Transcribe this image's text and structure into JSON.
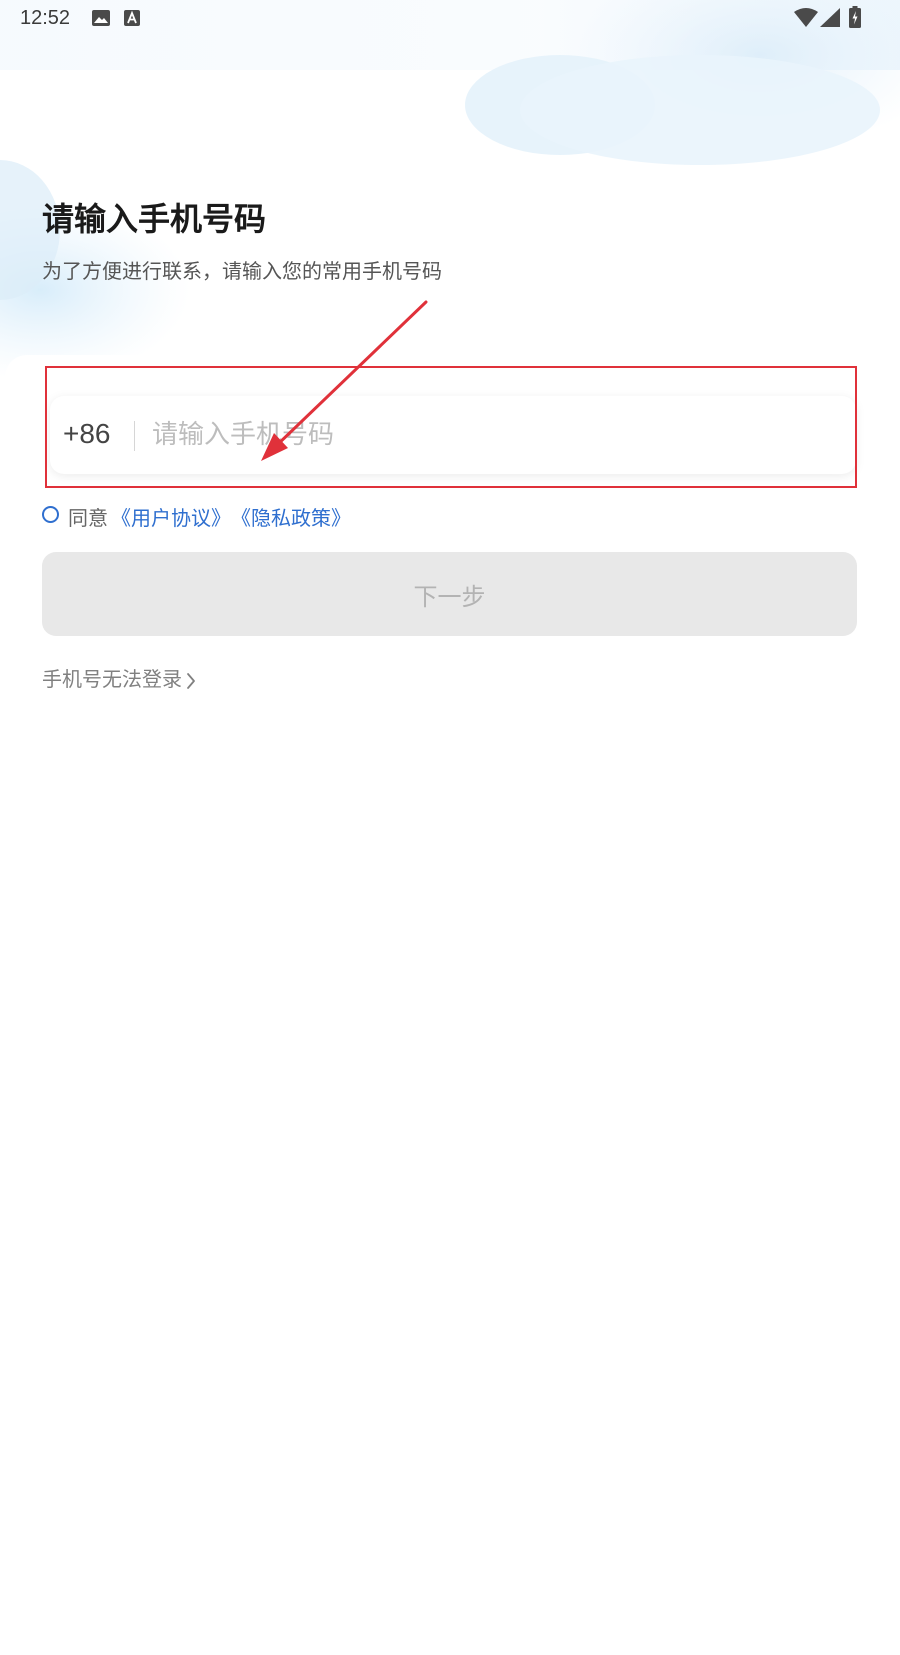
{
  "status_bar": {
    "time": "12:52",
    "left_icons": [
      "image-icon",
      "a-icon"
    ],
    "right_icons": [
      "wifi-icon",
      "cellular-signal-icon",
      "battery-charging-icon"
    ]
  },
  "header": {
    "title": "请输入手机号码",
    "subtitle": "为了方便进行联系，请输入您的常用手机号码"
  },
  "phone_input": {
    "country_code": "+86",
    "placeholder": "请输入手机号码",
    "value": ""
  },
  "agreement": {
    "checked": false,
    "prefix": "同意",
    "user_agreement": "《用户协议》",
    "privacy_policy": "《隐私政策》"
  },
  "next_button": {
    "label": "下一步",
    "enabled": false
  },
  "help_link": {
    "label": "手机号无法登录"
  },
  "colors": {
    "link": "#2f6fcf",
    "annotation": "#e0313a",
    "disabled_button_bg": "#e8e8e8",
    "disabled_button_text": "#b3b3b3"
  }
}
